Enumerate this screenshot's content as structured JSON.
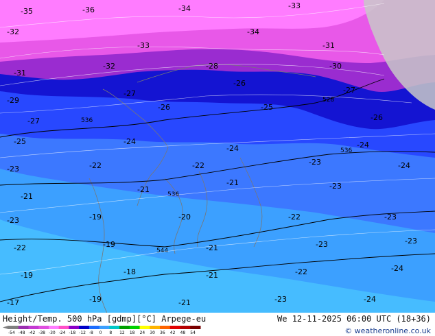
{
  "footer": {
    "title": "Height/Temp. 500 hPa [gdmp][°C] Arpege-eu",
    "datetime": "We 12-11-2025 06:00 UTC (18+36)",
    "credit": "© weatheronline.co.uk"
  },
  "colorbar": {
    "ticks": [
      "-54",
      "-48",
      "-42",
      "-38",
      "-30",
      "-24",
      "-18",
      "-12",
      "-8",
      "0",
      "8",
      "12",
      "18",
      "24",
      "30",
      "36",
      "42",
      "48",
      "54"
    ],
    "colors": [
      "#808080",
      "#9b2fb0",
      "#c43ad2",
      "#e050e0",
      "#ff7cff",
      "#ff50c8",
      "#8b00c8",
      "#0000c8",
      "#1e6eff",
      "#3ca0ff",
      "#00c8c8",
      "#00a000",
      "#00d200",
      "#ffff00",
      "#ffb400",
      "#ff6400",
      "#e10000",
      "#b40000",
      "#780000"
    ]
  },
  "map_labels": {
    "gpm_contours": [
      "536",
      "528",
      "536",
      "536",
      "544"
    ],
    "temperature_values": [
      "-36",
      "-35",
      "-34",
      "-33",
      "-32",
      "-31",
      "-30",
      "-29",
      "-28",
      "-27",
      "-26",
      "-25",
      "-24",
      "-23",
      "-22",
      "-21",
      "-20",
      "-19",
      "-18",
      "-17"
    ]
  },
  "colors": {
    "band_magenta": "#e858e8",
    "band_pink": "#ff7cff",
    "band_purple": "#9a2cd0",
    "band_deep_blue": "#1414d2",
    "band_blue": "#2848ff",
    "band_mid_blue": "#3c78ff",
    "band_light_blue": "#3ca0ff",
    "band_cyan": "#46bcff",
    "land_gray": "#c8c8c8"
  }
}
